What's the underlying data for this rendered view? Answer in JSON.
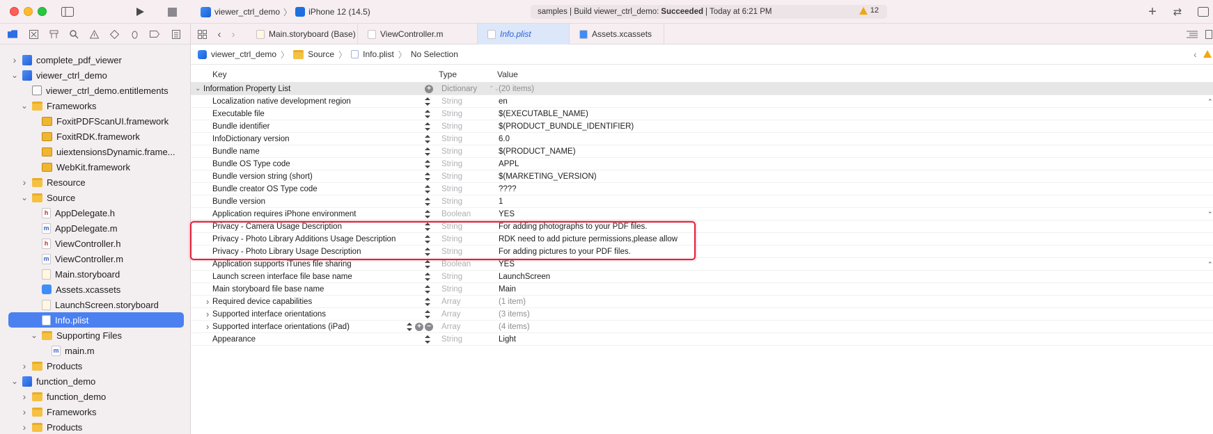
{
  "toolbar": {
    "scheme_project": "viewer_ctrl_demo",
    "scheme_sep": "〉",
    "scheme_device": "iPhone 12 (14.5)",
    "status_prefix": "samples | Build viewer_ctrl_demo:",
    "status_result": "Succeeded",
    "status_time": "| Today at 6:21 PM",
    "warning_count": "12"
  },
  "navigator": {
    "items": [
      {
        "label": "complete_pdf_viewer",
        "icon": "project",
        "depth": 0,
        "disclosure": "closed"
      },
      {
        "label": "viewer_ctrl_demo",
        "icon": "project",
        "depth": 0,
        "disclosure": "open"
      },
      {
        "label": "viewer_ctrl_demo.entitlements",
        "icon": "entitlements",
        "depth": 1,
        "disclosure": "none"
      },
      {
        "label": "Frameworks",
        "icon": "folder",
        "depth": 1,
        "disclosure": "open"
      },
      {
        "label": "FoxitPDFScanUI.framework",
        "icon": "framework",
        "depth": 2,
        "disclosure": "none"
      },
      {
        "label": "FoxitRDK.framework",
        "icon": "framework",
        "depth": 2,
        "disclosure": "none"
      },
      {
        "label": "uiextensionsDynamic.frame...",
        "icon": "framework",
        "depth": 2,
        "disclosure": "none"
      },
      {
        "label": "WebKit.framework",
        "icon": "framework",
        "depth": 2,
        "disclosure": "none"
      },
      {
        "label": "Resource",
        "icon": "folder",
        "depth": 1,
        "disclosure": "closed"
      },
      {
        "label": "Source",
        "icon": "folder",
        "depth": 1,
        "disclosure": "open"
      },
      {
        "label": "AppDelegate.h",
        "icon": "h",
        "depth": 2,
        "disclosure": "none"
      },
      {
        "label": "AppDelegate.m",
        "icon": "m",
        "depth": 2,
        "disclosure": "none"
      },
      {
        "label": "ViewController.h",
        "icon": "h",
        "depth": 2,
        "disclosure": "none"
      },
      {
        "label": "ViewController.m",
        "icon": "m",
        "depth": 2,
        "disclosure": "none"
      },
      {
        "label": "Main.storyboard",
        "icon": "storyboard",
        "depth": 2,
        "disclosure": "none"
      },
      {
        "label": "Assets.xcassets",
        "icon": "xcassets",
        "depth": 2,
        "disclosure": "none"
      },
      {
        "label": "LaunchScreen.storyboard",
        "icon": "storyboard",
        "depth": 2,
        "disclosure": "none"
      },
      {
        "label": "Info.plist",
        "icon": "plist",
        "depth": 2,
        "disclosure": "none",
        "selected": true
      },
      {
        "label": "Supporting Files",
        "icon": "folder",
        "depth": 2,
        "disclosure": "open"
      },
      {
        "label": "main.m",
        "icon": "m",
        "depth": 3,
        "disclosure": "none"
      },
      {
        "label": "Products",
        "icon": "folder",
        "depth": 1,
        "disclosure": "closed"
      },
      {
        "label": "function_demo",
        "icon": "project",
        "depth": 0,
        "disclosure": "open"
      },
      {
        "label": "function_demo",
        "icon": "folder",
        "depth": 1,
        "disclosure": "closed"
      },
      {
        "label": "Frameworks",
        "icon": "folder",
        "depth": 1,
        "disclosure": "closed"
      },
      {
        "label": "Products",
        "icon": "folder",
        "depth": 1,
        "disclosure": "closed"
      }
    ]
  },
  "tabs": [
    {
      "label": "Main.storyboard (Base)",
      "icon": "storyboard"
    },
    {
      "label": "ViewController.m",
      "icon": "m"
    },
    {
      "label": "Info.plist",
      "icon": "plist",
      "active": true
    },
    {
      "label": "Assets.xcassets",
      "icon": "xcassets"
    }
  ],
  "breadcrumb": {
    "project": "viewer_ctrl_demo",
    "folder": "Source",
    "file": "Info.plist",
    "selection": "No Selection",
    "sep": "〉"
  },
  "plist": {
    "headers": {
      "key": "Key",
      "type": "Type",
      "value": "Value"
    },
    "root": {
      "key": "Information Property List",
      "type": "Dictionary",
      "value": "(20 items)"
    },
    "rows": [
      {
        "key": "Localization native development region",
        "type": "String",
        "value": "en"
      },
      {
        "key": "Executable file",
        "type": "String",
        "value": "$(EXECUTABLE_NAME)"
      },
      {
        "key": "Bundle identifier",
        "type": "String",
        "value": "$(PRODUCT_BUNDLE_IDENTIFIER)"
      },
      {
        "key": "InfoDictionary version",
        "type": "String",
        "value": "6.0"
      },
      {
        "key": "Bundle name",
        "type": "String",
        "value": "$(PRODUCT_NAME)"
      },
      {
        "key": "Bundle OS Type code",
        "type": "String",
        "value": "APPL"
      },
      {
        "key": "Bundle version string (short)",
        "type": "String",
        "value": "$(MARKETING_VERSION)"
      },
      {
        "key": "Bundle creator OS Type code",
        "type": "String",
        "value": "????"
      },
      {
        "key": "Bundle version",
        "type": "String",
        "value": "1"
      },
      {
        "key": "Application requires iPhone environment",
        "type": "Boolean",
        "value": "YES"
      },
      {
        "key": "Privacy - Camera Usage Description",
        "type": "String",
        "value": "For adding photographs to your PDF files."
      },
      {
        "key": "Privacy - Photo Library Additions Usage Description",
        "type": "String",
        "value": "RDK need to add picture permissions,please allow"
      },
      {
        "key": "Privacy - Photo Library Usage Description",
        "type": "String",
        "value": "For adding pictures to your PDF files."
      },
      {
        "key": "Application supports iTunes file sharing",
        "type": "Boolean",
        "value": "YES"
      },
      {
        "key": "Launch screen interface file base name",
        "type": "String",
        "value": "LaunchScreen"
      },
      {
        "key": "Main storyboard file base name",
        "type": "String",
        "value": "Main"
      },
      {
        "key": "Required device capabilities",
        "type": "Array",
        "value": "(1 item)",
        "expandable": true
      },
      {
        "key": "Supported interface orientations",
        "type": "Array",
        "value": "(3 items)",
        "expandable": true
      },
      {
        "key": "Supported interface orientations (iPad)",
        "type": "Array",
        "value": "(4 items)",
        "expandable": true,
        "hovered": true
      },
      {
        "key": "Appearance",
        "type": "String",
        "value": "Light"
      }
    ]
  },
  "colors": {
    "selection": "#4b80f0",
    "highlight_box": "#e0203a",
    "active_tab": "#dde7fa"
  }
}
